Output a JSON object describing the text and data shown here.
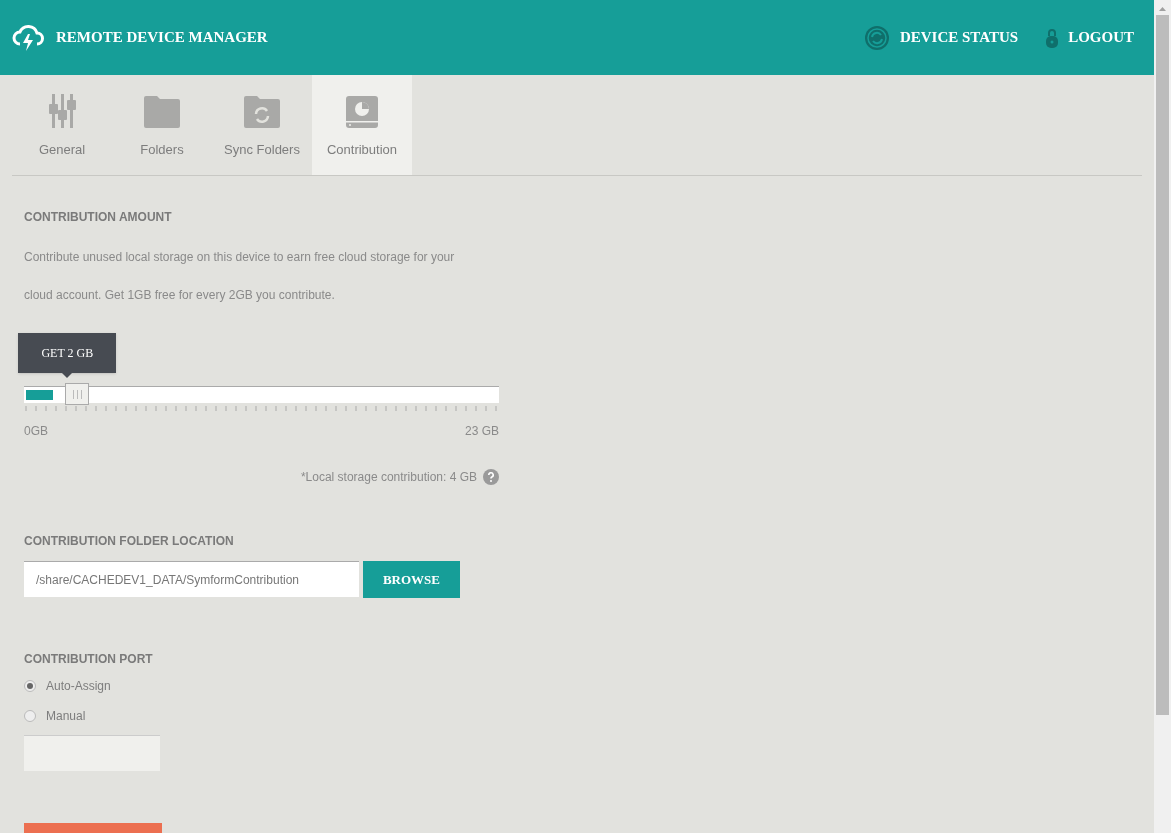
{
  "header": {
    "title": "REMOTE DEVICE MANAGER",
    "links": [
      {
        "kind": "status",
        "label": "DEVICE STATUS"
      },
      {
        "kind": "logout",
        "label": "LOGOUT"
      }
    ]
  },
  "tabs": [
    {
      "kind": "sliders",
      "label": "General",
      "selected": false
    },
    {
      "kind": "folder",
      "label": "Folders",
      "selected": false
    },
    {
      "kind": "sync",
      "label": "Sync Folders",
      "selected": false
    },
    {
      "kind": "drive",
      "label": "Contribution",
      "selected": true
    }
  ],
  "amount": {
    "heading": "CONTRIBUTION AMOUNT",
    "description": "Contribute unused local storage on this device to earn free cloud storage for your cloud account. Get 1GB free for every 2GB you contribute.",
    "tooltip": "GET 2 GB",
    "level": 0.087,
    "min_label": "0GB",
    "max_label": "23 GB",
    "note": "*Local storage contribution: 4 GB"
  },
  "folder": {
    "heading": "CONTRIBUTION FOLDER LOCATION",
    "value": "/share/CACHEDEV1_DATA/SymformContribution",
    "button": "BROWSE"
  },
  "port": {
    "heading": "CONTRIBUTION PORT",
    "options": [
      {
        "label": "Auto-Assign",
        "selected": true
      },
      {
        "label": "Manual",
        "selected": false
      }
    ]
  }
}
